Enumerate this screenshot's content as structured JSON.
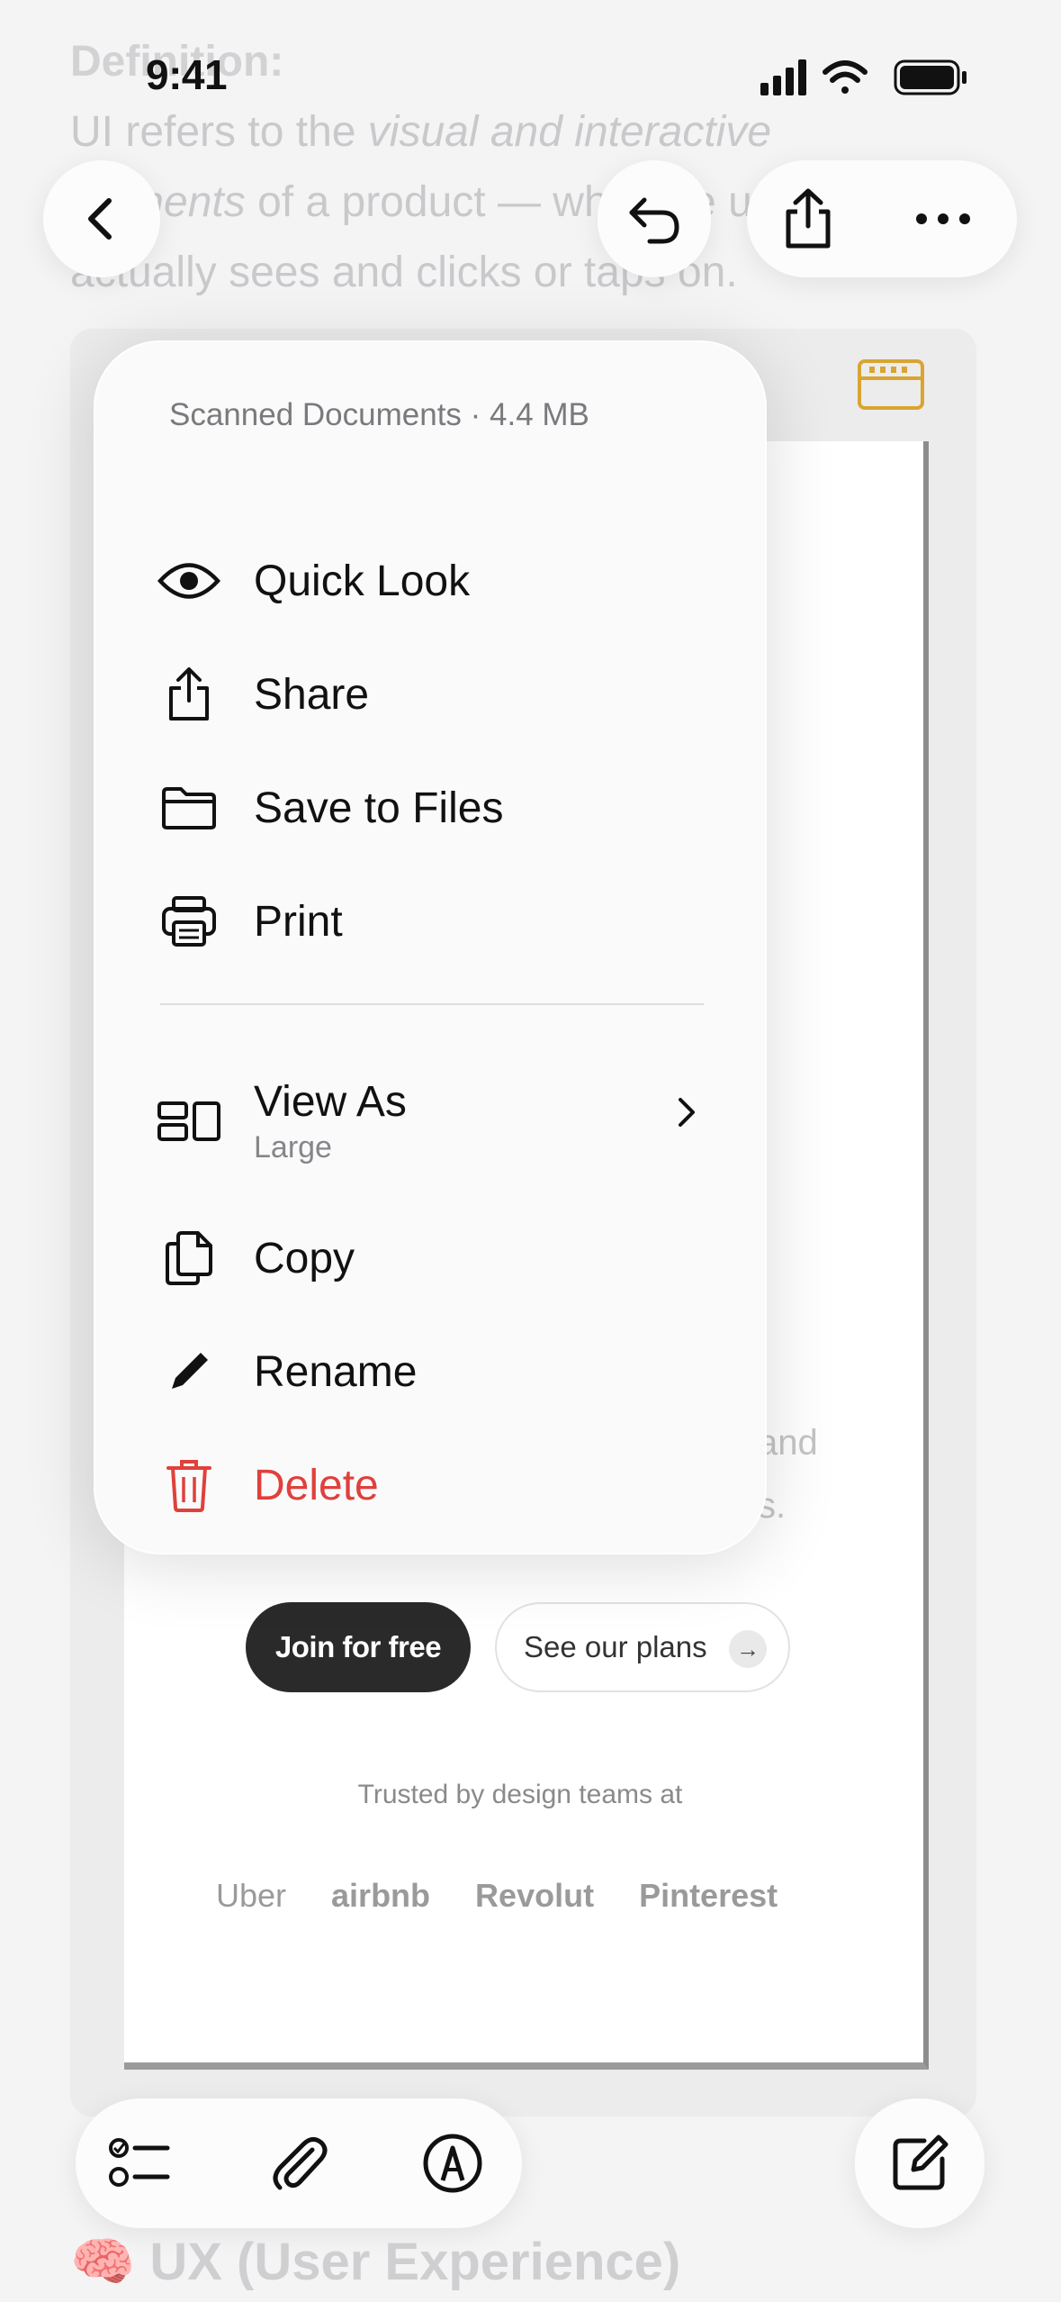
{
  "status_bar": {
    "time": "9:41"
  },
  "note": {
    "definition_label": "Definition:",
    "line1": "UI refers to the visual and interactive",
    "line1_prefix": "UI refers to the ",
    "line1_italic": "visual and interactive",
    "line2_italic": "elements",
    "line2_rest": " of a product — what the user",
    "line3": "actually sees and clicks or taps on.",
    "footer_heading": "🧠 UX (User Experience)"
  },
  "toolbar": {
    "back_icon": "chevron-left-icon",
    "undo_icon": "undo-icon",
    "share_icon": "share-icon",
    "more_icon": "ellipsis-icon"
  },
  "attachment_preview": {
    "and_text": "and",
    "s_text": "s.",
    "join_button": "Join for free",
    "plans_button": "See our plans",
    "trusted_text": "Trusted by design teams at",
    "logos": [
      "Uber",
      "airbnb",
      "Revolut",
      "Pinterest"
    ]
  },
  "context_menu": {
    "header": "Scanned Documents · 4.4 MB",
    "items": [
      {
        "label": "Quick Look",
        "icon": "eye-icon"
      },
      {
        "label": "Share",
        "icon": "share-icon"
      },
      {
        "label": "Save to Files",
        "icon": "folder-icon"
      },
      {
        "label": "Print",
        "icon": "printer-icon"
      },
      {
        "label": "View As",
        "sublabel": "Large",
        "icon": "view-as-icon"
      },
      {
        "label": "Copy",
        "icon": "copy-icon"
      },
      {
        "label": "Rename",
        "icon": "pencil-icon"
      },
      {
        "label": "Delete",
        "icon": "trash-icon"
      }
    ],
    "danger_color": "#E0403C"
  },
  "bottom_toolbar": {
    "tools": [
      "checklist-icon",
      "paperclip-icon",
      "markup-icon"
    ],
    "compose_icon": "compose-icon"
  }
}
